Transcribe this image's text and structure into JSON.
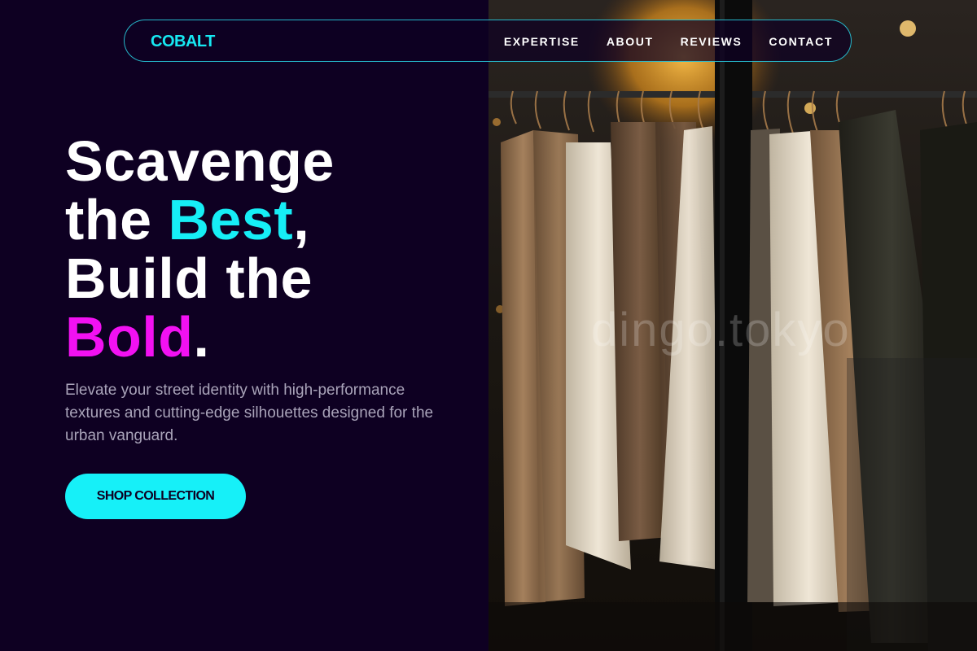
{
  "brand": {
    "name": "COBALT"
  },
  "nav": {
    "links": [
      "EXPERTISE",
      "ABOUT",
      "REVIEWS",
      "CONTACT"
    ]
  },
  "hero": {
    "line1": "Scavenge",
    "line2_a": "the ",
    "line2_accent": "Best",
    "line2_b": ",",
    "line3": "Build the",
    "line4_accent": "Bold",
    "line4_b": ".",
    "subtitle": "Elevate your street identity with high-performance textures and cutting-edge silhouettes designed for the urban vanguard.",
    "cta_label": "SHOP COLLECTION"
  },
  "photo": {
    "watermark": "dingo.tokyo",
    "subject": "clothes-rack-photo"
  },
  "colors": {
    "background": "#0e0022",
    "accent_cyan": "#16eef6",
    "accent_magenta": "#f211f2",
    "nav_border": "#2ad6e8",
    "subtitle": "#a9a3b9"
  }
}
